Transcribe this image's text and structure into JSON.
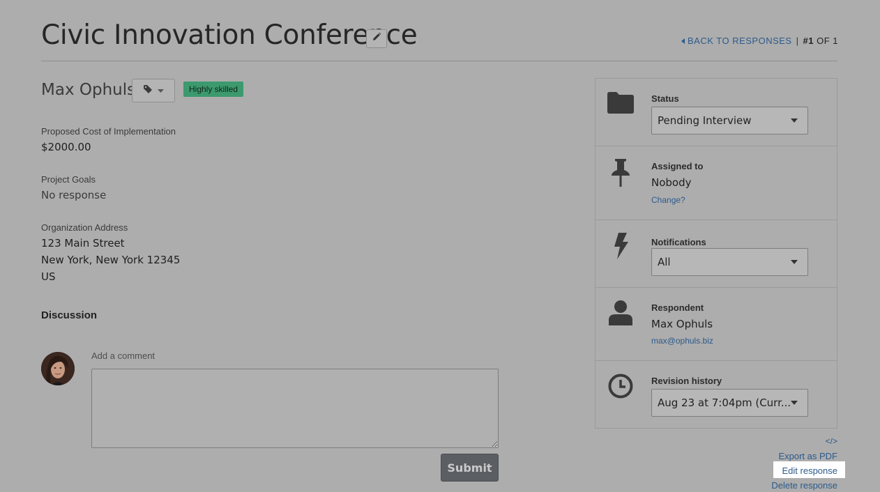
{
  "header": {
    "title": "Civic Innovation Conference",
    "back_label": "BACK TO RESPONSES",
    "separator": "|",
    "position_current": "#1",
    "position_rest": "OF 1"
  },
  "respondent_header": {
    "name": "Max Ophuls",
    "badge": "Highly skilled",
    "badge_color": "#3c9a6e"
  },
  "fields": [
    {
      "label": "Proposed Cost of Implementation",
      "value": "$2000.00"
    },
    {
      "label": "Project Goals",
      "value": "No response"
    },
    {
      "label": "Organization Address",
      "lines": [
        "123 Main Street",
        "New York, New York 12345",
        "US"
      ]
    }
  ],
  "discussion": {
    "heading": "Discussion",
    "comment_label": "Add a comment",
    "comment_value": "",
    "submit_label": "Submit"
  },
  "sidebar": {
    "status": {
      "label": "Status",
      "value": "Pending Interview",
      "icon": "folder-icon"
    },
    "assigned": {
      "label": "Assigned to",
      "value": "Nobody",
      "link": "Change?",
      "icon": "pushpin-icon"
    },
    "notifications": {
      "label": "Notifications",
      "value": "All",
      "icon": "lightning-icon"
    },
    "respondent": {
      "label": "Respondent",
      "value": "Max Ophuls",
      "email": "max@ophuls.biz",
      "icon": "user-icon"
    },
    "revision": {
      "label": "Revision history",
      "value": "Aug 23 at 7:04pm (Curr...",
      "icon": "clock-icon"
    }
  },
  "actions": {
    "embed": "</>",
    "export_pdf": "Export as PDF",
    "edit_response": "Edit response",
    "delete_response": "Delete response"
  },
  "colors": {
    "link": "#2c5a8c",
    "background": "#adadad",
    "submit_button": "#5b5f64"
  }
}
